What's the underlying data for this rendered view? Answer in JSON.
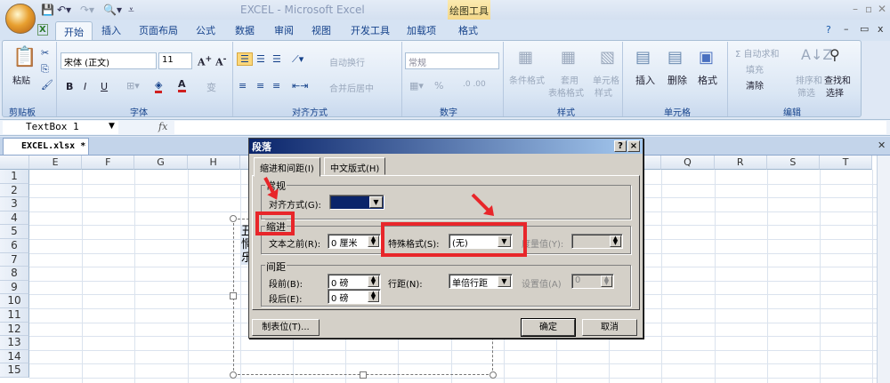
{
  "app": {
    "title": "EXCEL - Microsoft Excel",
    "context_tab": "绘图工具",
    "quick_access": [
      "save",
      "undo",
      "redo",
      "print-preview"
    ]
  },
  "tabs": [
    "开始",
    "插入",
    "页面布局",
    "公式",
    "数据",
    "审阅",
    "视图",
    "开发工具",
    "加载项",
    "格式"
  ],
  "ribbon": {
    "clipboard": {
      "label": "剪贴板",
      "paste": "粘贴"
    },
    "font": {
      "label": "字体",
      "name": "宋体 (正文)",
      "size": "11",
      "bold": "B",
      "italic": "I",
      "underline": "U",
      "wen": "变"
    },
    "alignment": {
      "label": "对齐方式",
      "wrap": "自动换行",
      "merge": "合并后居中"
    },
    "number": {
      "label": "数字",
      "format": "常规",
      "percent": "%"
    },
    "styles": {
      "label": "样式",
      "conditional": "条件格式",
      "table1": "套用",
      "table2": "表格格式",
      "cell1": "单元格",
      "cell2": "样式"
    },
    "cells": {
      "label": "单元格",
      "insert": "插入",
      "delete": "删除",
      "format": "格式"
    },
    "editing": {
      "label": "编辑",
      "autosum": "Σ 自动求和",
      "fill": "填充",
      "clear": "清除",
      "sort1": "排序和",
      "sort2": "筛选",
      "find1": "查找和",
      "find2": "选择"
    }
  },
  "formula_bar": {
    "name_box": "TextBox 1",
    "fx": "fx"
  },
  "workbook_tab": "EXCEL.xlsx *",
  "columns_left": [
    "E",
    "F",
    "G",
    "H"
  ],
  "columns_right": [
    "Q",
    "R",
    "S",
    "T"
  ],
  "rows": [
    "1",
    "2",
    "3",
    "4",
    "5",
    "6",
    "7",
    "8",
    "9",
    "10",
    "11",
    "12",
    "13",
    "14",
    "15"
  ],
  "textbox_chars": [
    "丑",
    "惘",
    "乐"
  ],
  "dialog": {
    "title": "段落",
    "help": "?",
    "close": "×",
    "tabs": [
      "缩进和间距(I)",
      "中文版式(H)"
    ],
    "general": {
      "label": "常规",
      "alignment_label": "对齐方式(G):"
    },
    "indent": {
      "label": "缩进",
      "before_text_label": "文本之前(R):",
      "before_text_value": "0 厘米",
      "special_label": "特殊格式(S):",
      "special_value": "(无)",
      "by_label": "度量值(Y):"
    },
    "spacing": {
      "label": "间距",
      "before_label": "段前(B):",
      "before_value": "0 磅",
      "after_label": "段后(E):",
      "after_value": "0 磅",
      "line_label": "行距(N):",
      "line_value": "单倍行距",
      "at_label": "设置值(A)",
      "at_value": "0"
    },
    "tabs_button": "制表位(T)...",
    "ok": "确定",
    "cancel": "取消"
  },
  "annotation_color": "#e8262a"
}
